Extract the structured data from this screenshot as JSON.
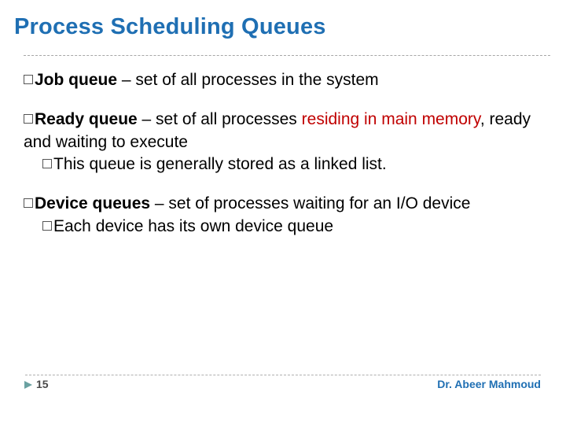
{
  "title": "Process Scheduling Queues",
  "bullets": {
    "job": {
      "bold": "Job queue ",
      "text": "– set of all processes in the system"
    },
    "ready": {
      "bold": "Ready queue ",
      "text1": "– set of all processes ",
      "red": "residing in main memory",
      "text2": ", ready and waiting to execute",
      "sub": "This queue is generally stored as a linked list."
    },
    "device": {
      "bold": "Device queues ",
      "text": "– set of processes waiting for an I/O device",
      "sub": "Each device has its own device queue"
    }
  },
  "page": "15",
  "author": "Dr. Abeer Mahmoud"
}
